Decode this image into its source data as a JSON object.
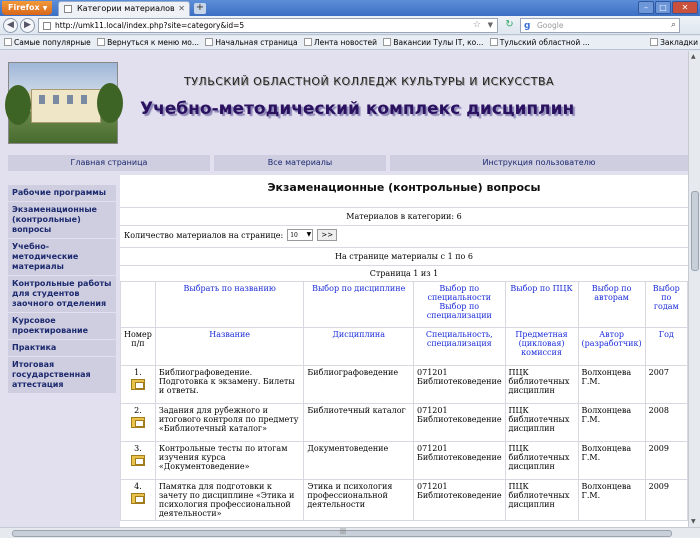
{
  "browser": {
    "menu_label": "Firefox",
    "tab_title": "Категории материалов",
    "url": "http://umk11.local/index.php?site=category&id=5",
    "search_placeholder": "Google",
    "bookmarks": [
      "Самые популярные",
      "Вернуться к меню мо...",
      "Начальная страница",
      "Лента новостей",
      "Вакансии Тулы IT, ко...",
      "Тульский областной ..."
    ],
    "bookmarks_menu": "Закладки"
  },
  "site": {
    "college_name": "ТУЛЬСКИЙ ОБЛАСТНОЙ КОЛЛЕДЖ КУЛЬТУРЫ И ИСКУССТВА",
    "complex_title": "Учебно-методический комплекс дисциплин",
    "topnav": [
      "Главная страница",
      "Все материалы",
      "Инструкция пользователю"
    ],
    "sidebar": [
      "Рабочие программы",
      "Экзаменационные (контрольные) вопросы",
      "Учебно-методические материалы",
      "Контрольные работы для студентов заочного отделения",
      "Курсовое проектирование",
      "Практика",
      "Итоговая государственная аттестация"
    ]
  },
  "main": {
    "heading": "Экзаменационные (контрольные) вопросы",
    "materials_count": "Материалов в категории: 6",
    "per_page_label": "Количество материалов на странице:",
    "per_page_value": "10",
    "go_button": ">>",
    "range_text": "На странице материалы с 1 по 6",
    "page_text": "Страница 1 из 1",
    "filters": [
      "Выбрать по названию",
      "Выбор по дисциплине",
      "Выбор по специальности Выбор по специализации",
      "Выбор по ПЦК",
      "Выбор по авторам",
      "Выбор по годам"
    ],
    "columns": [
      "Номер п/п",
      "Название",
      "Дисциплина",
      "Специальность, специализация",
      "Предметная (цикловая) комиссия",
      "Автор (разработчик)",
      "Год"
    ],
    "rows": [
      {
        "num": "1.",
        "title": "Библиографоведение. Подготовка к экзамену. Билеты и ответы.",
        "discipline": "Библиографоведение",
        "spec": "071201 Библиотековедение",
        "pck": "ПЦК библиотечных дисциплин",
        "author": "Волхонцева Г.М.",
        "year": "2007"
      },
      {
        "num": "2.",
        "title": "Задания для рубежного и итогового контроля по предмету «Библиотечный каталог»",
        "discipline": "Библиотечный каталог",
        "spec": "071201 Библиотековедение",
        "pck": "ПЦК библиотечных дисциплин",
        "author": "Волхонцева Г.М.",
        "year": "2008"
      },
      {
        "num": "3.",
        "title": "Контрольные тесты по итогам изучения курса «Документоведение»",
        "discipline": "Документоведение",
        "spec": "071201 Библиотековедение",
        "pck": "ПЦК библиотечных дисциплин",
        "author": "Волхонцева Г.М.",
        "year": "2009"
      },
      {
        "num": "4.",
        "title": "Памятка для подготовки к зачету по дисциплине «Этика и психология профессиональной деятельности»",
        "discipline": "Этика и психология профессиональной деятельности",
        "spec": "071201 Библиотековедение",
        "pck": "ПЦК библиотечных дисциплин",
        "author": "Волхонцева Г.М.",
        "year": "2009"
      }
    ]
  }
}
